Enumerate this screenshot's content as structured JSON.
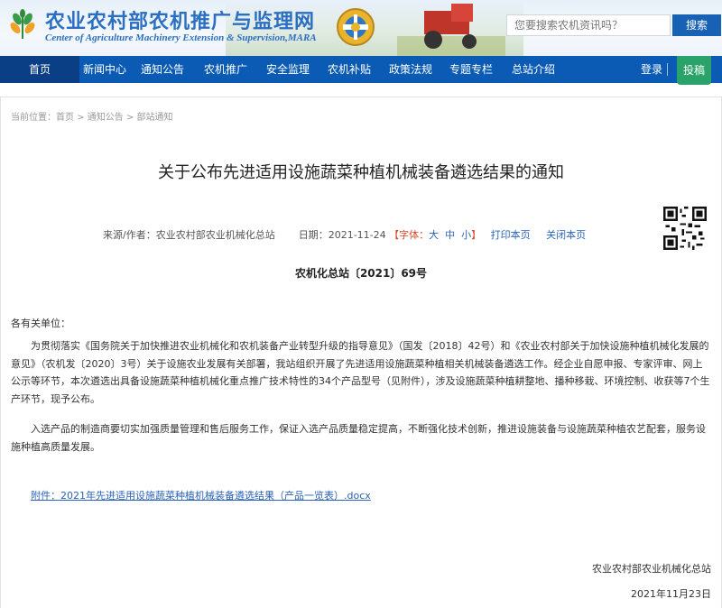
{
  "header": {
    "site_title": "农业农村部农机推广与监理网",
    "site_subtitle": "Center of Agriculture Machinery Extension & Supervision,MARA",
    "search_placeholder": "您要搜索农机资讯吗？",
    "search_button": "搜索"
  },
  "nav": {
    "items": [
      "首页",
      "新闻中心",
      "通知公告",
      "农机推广",
      "安全监理",
      "农机补贴",
      "政策法规",
      "专题专栏",
      "总站介绍"
    ],
    "active_index": 0,
    "login": "登录",
    "submit": "投稿"
  },
  "breadcrumb": {
    "prefix": "当前位置：",
    "items": [
      "首页",
      "通知公告",
      "部站通知"
    ],
    "separator": " > "
  },
  "article": {
    "title": "关于公布先进适用设施蔬菜种植机械装备遴选结果的通知",
    "source_label": "来源/作者：",
    "source": "农业农村部农业机械化总站",
    "date_label": "日期：",
    "date": "2021-11-24",
    "font_label": "【字体：",
    "font_large": "大",
    "font_medium": "中",
    "font_small": "小",
    "font_close": "】",
    "print": "打印本页",
    "close": "关闭本页",
    "doc_number": "农机化总站〔2021〕69号",
    "salutation": "各有关单位：",
    "paragraphs": [
      "为贯彻落实《国务院关于加快推进农业机械化和农机装备产业转型升级的指导意见》（国发〔2018〕42号）和《农业农村部关于加快设施种植机械化发展的意见》（农机发〔2020〕3号）关于设施农业发展有关部署，我站组织开展了先进适用设施蔬菜种植相关机械装备遴选工作。经企业自愿申报、专家评审、网上公示等环节，本次遴选出具备设施蔬菜种植机械化重点推广技术特性的34个产品型号（见附件），涉及设施蔬菜种植耕整地、播种移栽、环境控制、收获等7个生产环节，现予公布。",
      "入选产品的制造商要切实加强质量管理和售后服务工作，保证入选产品质量稳定提高，不断强化技术创新，推进设施装备与设施蔬菜种植农艺配套，服务设施种植高质量发展。"
    ],
    "attachment": "附件：2021年先进适用设施蔬菜种植机械装备遴选结果（产品一览表）.docx",
    "signature_org": "农业农村部农业机械化总站",
    "signature_date": "2021年11月23日"
  },
  "colors": {
    "nav_bg": "#0b5bb5",
    "nav_active": "#0a3f85",
    "submit_bg": "#29a36a",
    "title_blue": "#2b6fc2",
    "link_blue": "#2a63b8",
    "highlight_red": "#d54b2b"
  },
  "icons": {
    "logo": "wheat-logo-icon",
    "emblem": "gear-wheat-emblem-icon",
    "qr": "qr-code-icon"
  }
}
